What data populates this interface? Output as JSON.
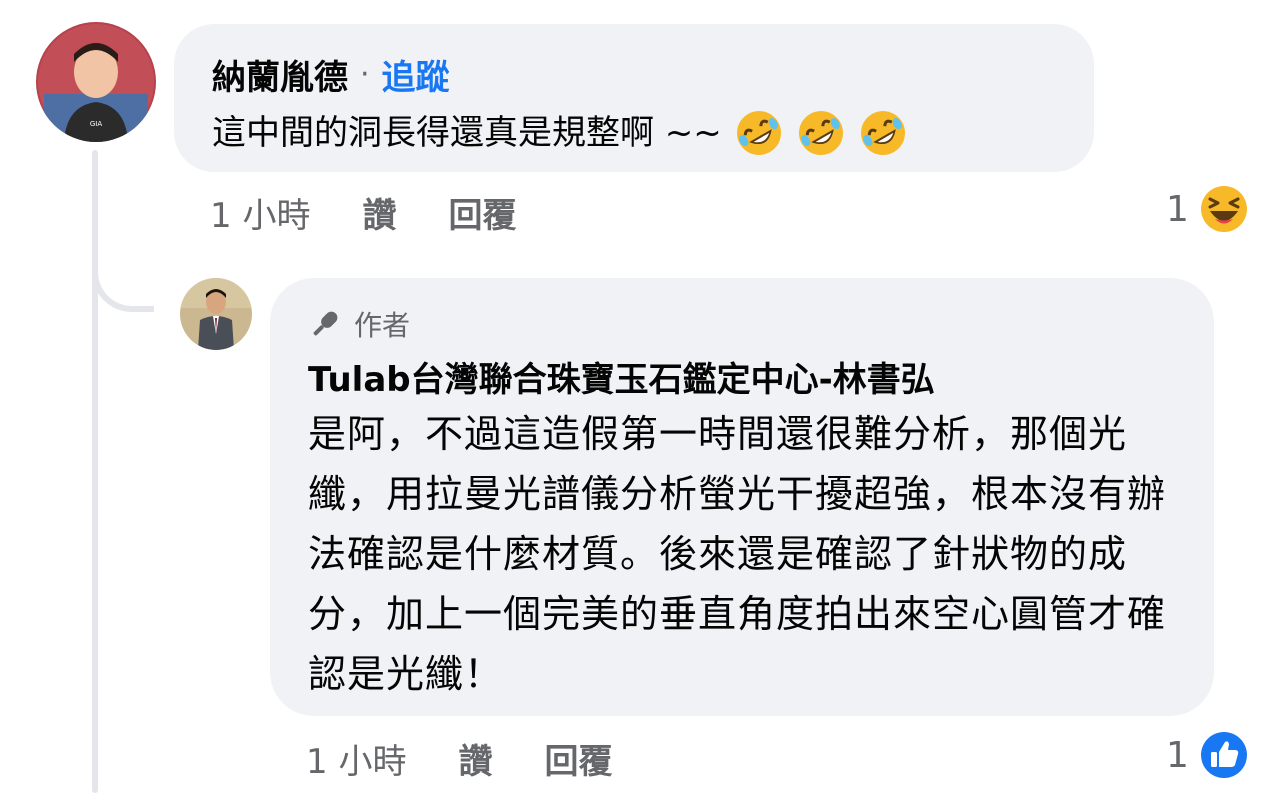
{
  "comment1": {
    "author": "納蘭胤德",
    "separator": "·",
    "follow_label": "追蹤",
    "text": "這中間的洞長得還真是規整啊 ~~",
    "emojis": [
      "rofl-emoji",
      "rofl-emoji",
      "rofl-emoji"
    ],
    "time": "1 小時",
    "like_label": "讚",
    "reply_label": "回覆",
    "reaction_count": "1",
    "reaction_icon": "laughing-emoji"
  },
  "comment2": {
    "badge_icon": "microphone-icon",
    "badge_label": "作者",
    "author": "Tulab台灣聯合珠寶玉石鑑定中心-林書弘",
    "text": "是阿，不過這造假第一時間還很難分析，那個光纖，用拉曼光譜儀分析螢光干擾超強，根本沒有辦法確認是什麼材質。後來還是確認了針狀物的成分，加上一個完美的垂直角度拍出來空心圓管才確認是光纖！",
    "time": "1 小時",
    "like_label": "讚",
    "reply_label": "回覆",
    "reaction_count": "1",
    "reaction_icon": "like-thumb-icon"
  },
  "colors": {
    "bubble": "#f0f2f5",
    "link": "#1877f2",
    "meta": "#65676b",
    "thread_line": "#e4e6eb"
  }
}
